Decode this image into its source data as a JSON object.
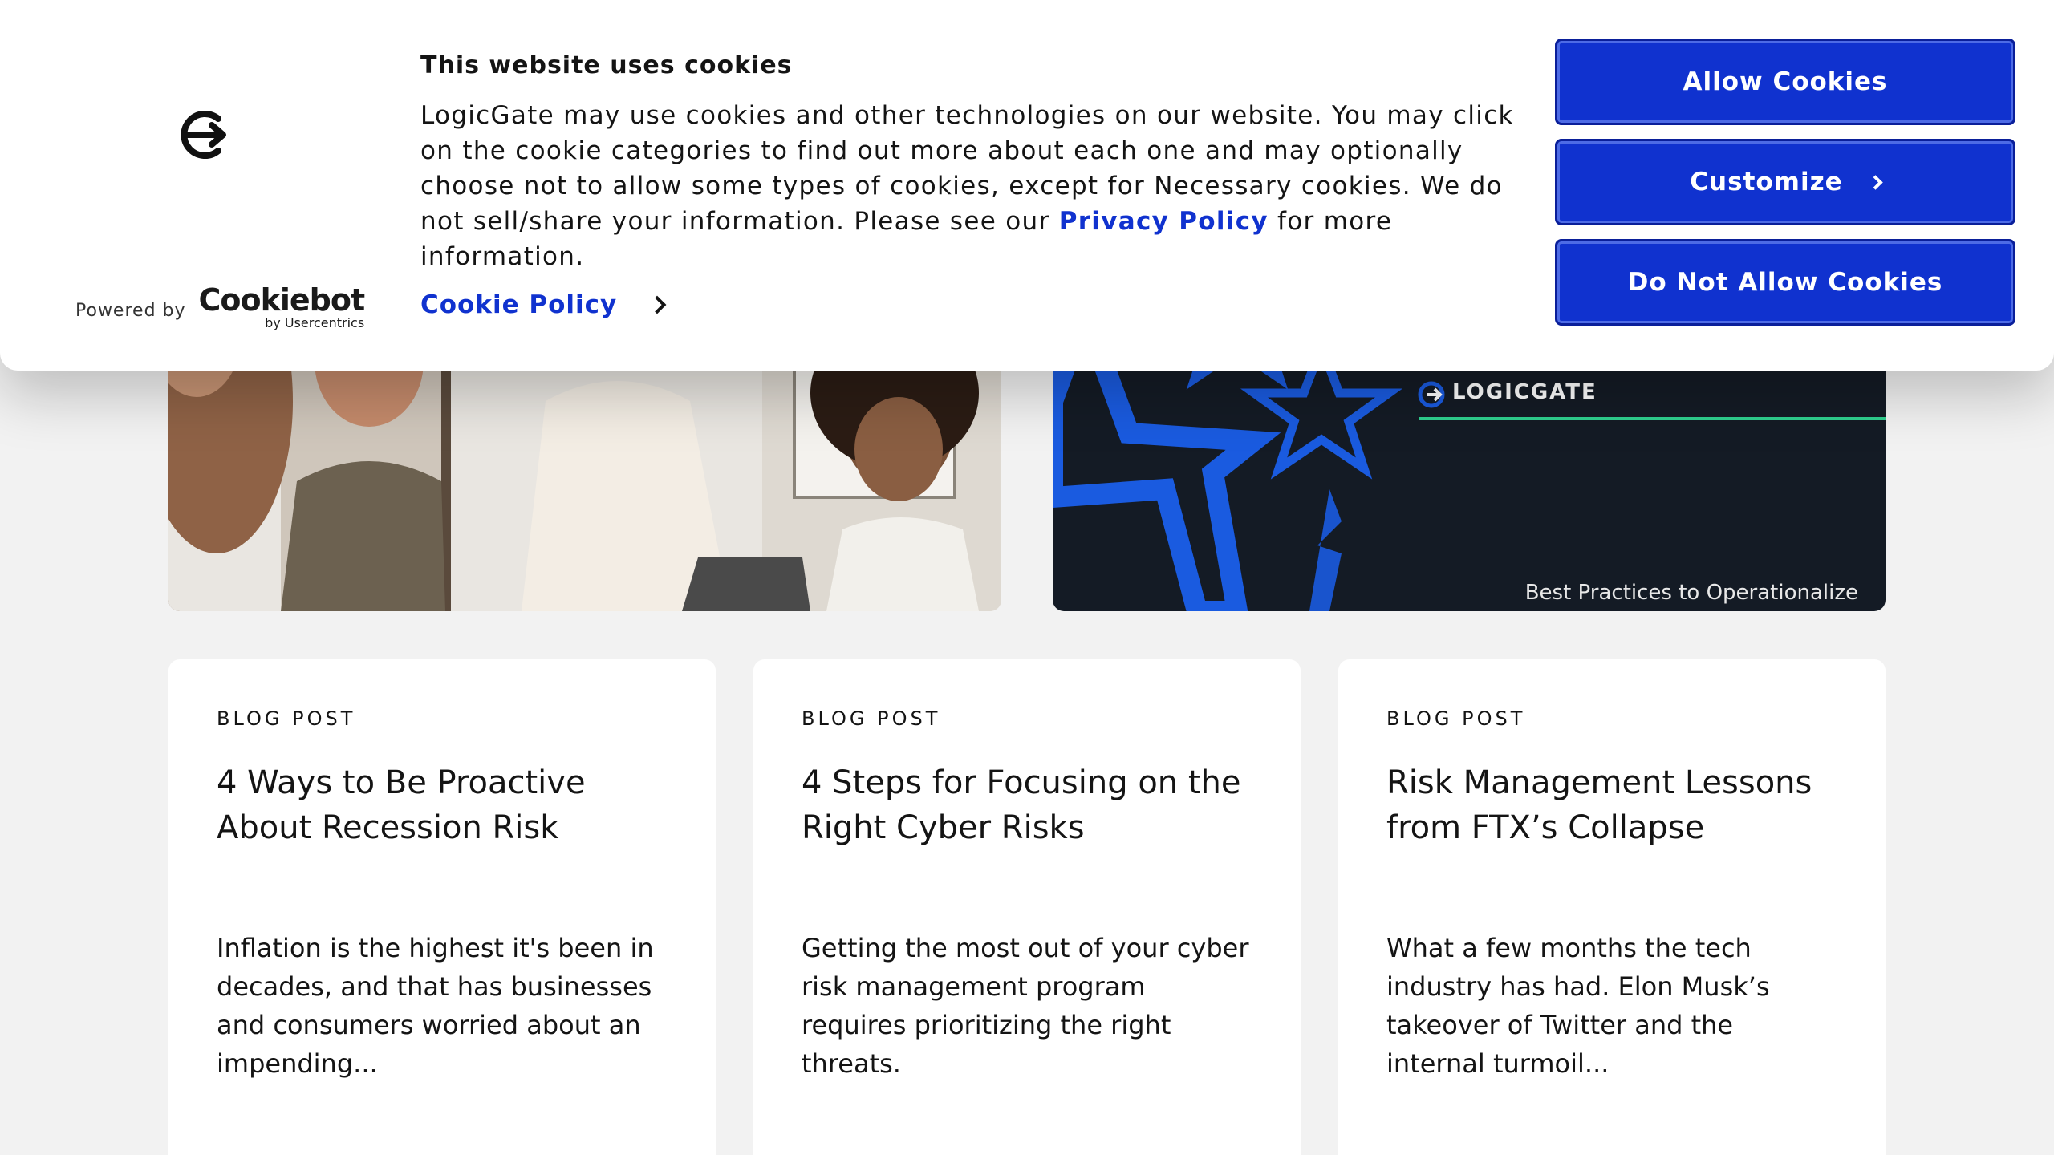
{
  "cookie_banner": {
    "title": "This website uses cookies",
    "body_text": "LogicGate may use cookies and other technologies on our website. You may click on the cookie categories to find out more about each one and may optionally choose not to allow some types of cookies, except for Necessary cookies.  We do not sell/share your information. Please see our ",
    "privacy_link": "Privacy Policy",
    "body_suffix": " for more information.",
    "cookie_policy_link": "Cookie Policy",
    "powered_by": "Powered by",
    "brand_main": "Cookiebot",
    "brand_sub": "by Usercentrics",
    "buttons": {
      "allow": "Allow Cookies",
      "customize": "Customize",
      "deny": "Do Not Allow Cookies"
    }
  },
  "featured": {
    "right_brand": "LOGICGATE",
    "right_caption": "Best Practices to Operationalize"
  },
  "cards": [
    {
      "tag": "BLOG POST",
      "title": "4 Ways to Be Proactive About Recession Risk",
      "excerpt": "Inflation is the highest it's been in decades, and that has businesses and consumers worried about an impending..."
    },
    {
      "tag": "BLOG POST",
      "title": "4 Steps for Focusing on the Right Cyber Risks",
      "excerpt": "Getting the most out of your cyber risk management program requires prioritizing the right threats."
    },
    {
      "tag": "BLOG POST",
      "title": "Risk Management Lessons from FTX’s Collapse",
      "excerpt": "What a few months the tech industry has had.  Elon Musk’s takeover of Twitter and the internal turmoil..."
    }
  ],
  "colors": {
    "accent": "#1032cf",
    "page_bg": "#f2f2f2",
    "feature_dark": "#141b25",
    "star_blue": "#1a5be0",
    "divider_green": "#2fd08f"
  }
}
